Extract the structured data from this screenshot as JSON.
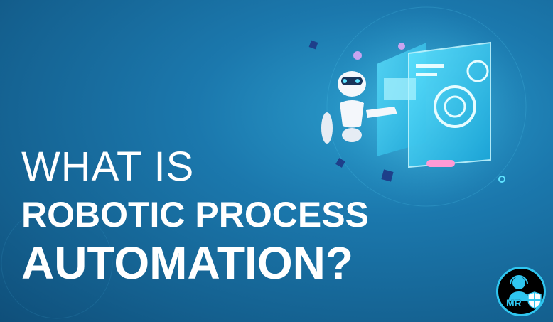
{
  "headline": {
    "line1": "WHAT IS",
    "line2": "ROBOTIC PROCESS",
    "line3": "AUTOMATION?"
  },
  "logo": {
    "text": "MR",
    "icon": "support-agent-shield-icon"
  },
  "colors": {
    "background": "#1b78ad",
    "accent": "#2fc6f0",
    "text": "#ffffff"
  }
}
